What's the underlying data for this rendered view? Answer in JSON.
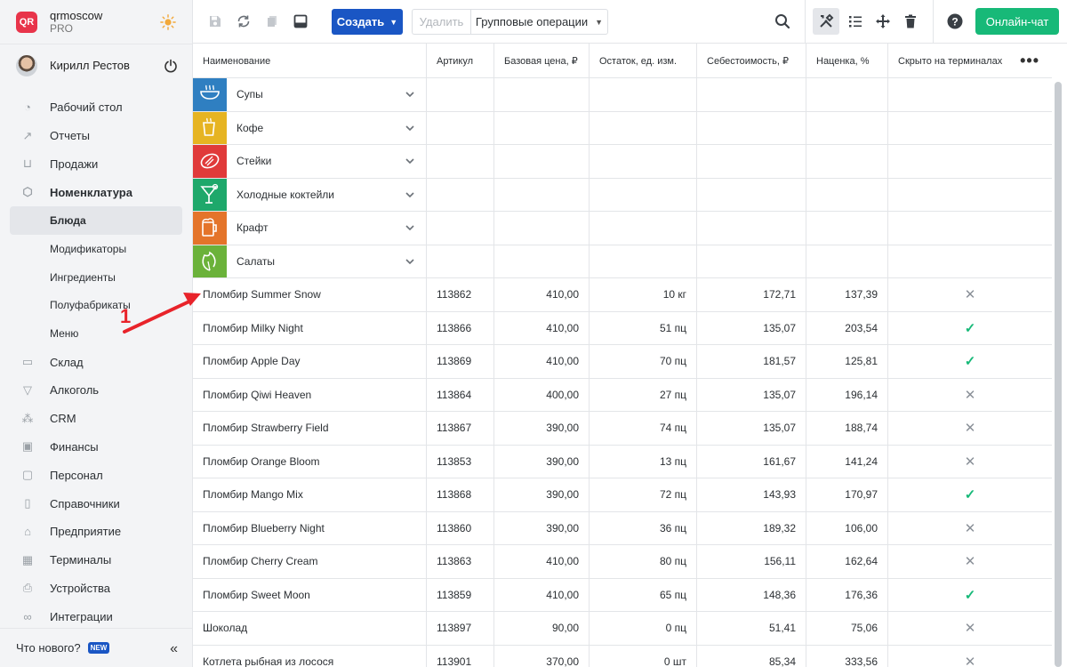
{
  "brand": {
    "name": "qrmoscow",
    "tier": "PRO",
    "logo_text": "QR"
  },
  "user": {
    "name": "Кирилл Рестов"
  },
  "nav": [
    {
      "label": "Рабочий стол",
      "icon": "dashboard-icon",
      "glyph": "◔"
    },
    {
      "label": "Отчеты",
      "icon": "reports-icon",
      "glyph": "↗"
    },
    {
      "label": "Продажи",
      "icon": "basket-icon",
      "glyph": "⊔"
    },
    {
      "label": "Номенклатура",
      "icon": "tag-icon",
      "glyph": "⬡"
    },
    {
      "label": "Блюда",
      "sub": true
    },
    {
      "label": "Модификаторы",
      "sub": true
    },
    {
      "label": "Ингредиенты",
      "sub": true
    },
    {
      "label": "Полуфабрикаты",
      "sub": true
    },
    {
      "label": "Меню",
      "sub": true
    },
    {
      "label": "Склад",
      "icon": "box-icon",
      "glyph": "▭"
    },
    {
      "label": "Алкоголь",
      "icon": "glass-icon",
      "glyph": "▽"
    },
    {
      "label": "CRM",
      "icon": "people-icon",
      "glyph": "⁂"
    },
    {
      "label": "Финансы",
      "icon": "wallet-icon",
      "glyph": "▣"
    },
    {
      "label": "Персонал",
      "icon": "badge-icon",
      "glyph": "▢"
    },
    {
      "label": "Справочники",
      "icon": "book-icon",
      "glyph": "▯"
    },
    {
      "label": "Предприятие",
      "icon": "building-icon",
      "glyph": "⌂"
    },
    {
      "label": "Терминалы",
      "icon": "terminal-icon",
      "glyph": "▦"
    },
    {
      "label": "Устройства",
      "icon": "printer-icon",
      "glyph": "⎙"
    },
    {
      "label": "Интеграции",
      "icon": "link-icon",
      "glyph": "∞"
    }
  ],
  "footer": {
    "whats_new": "Что нового?",
    "new_badge": "NEW"
  },
  "toolbar": {
    "create_label": "Создать",
    "delete_label": "Удалить",
    "group_ops_label": "Групповые операции",
    "chat_label": "Онлайн-чат"
  },
  "table": {
    "headers": [
      "Наименование",
      "Артикул",
      "Базовая цена, ₽",
      "Остаток, ед. изм.",
      "Себестоимость, ₽",
      "Наценка, %",
      "Скрыто на терминалах"
    ],
    "categories": [
      {
        "label": "Супы",
        "color": "#2f7fc1",
        "icon": "soup-icon"
      },
      {
        "label": "Кофе",
        "color": "#e6b422",
        "icon": "coffee-icon"
      },
      {
        "label": "Стейки",
        "color": "#e03a3a",
        "icon": "steak-icon"
      },
      {
        "label": "Холодные коктейли",
        "color": "#1ea86b",
        "icon": "cocktail-icon"
      },
      {
        "label": "Крафт",
        "color": "#e4742a",
        "icon": "beer-icon"
      },
      {
        "label": "Салаты",
        "color": "#6bb23a",
        "icon": "salad-icon"
      }
    ],
    "rows": [
      {
        "name": "Пломбир Summer Snow",
        "article": "113862",
        "price": "410,00",
        "stock": "10 кг",
        "cost": "172,71",
        "markup": "137,39",
        "hidden": false
      },
      {
        "name": "Пломбир Milky Night",
        "article": "113866",
        "price": "410,00",
        "stock": "51 пц",
        "cost": "135,07",
        "markup": "203,54",
        "hidden": true
      },
      {
        "name": "Пломбир Apple Day",
        "article": "113869",
        "price": "410,00",
        "stock": "70 пц",
        "cost": "181,57",
        "markup": "125,81",
        "hidden": true
      },
      {
        "name": "Пломбир Qiwi Heaven",
        "article": "113864",
        "price": "400,00",
        "stock": "27 пц",
        "cost": "135,07",
        "markup": "196,14",
        "hidden": false
      },
      {
        "name": "Пломбир Strawberry Field",
        "article": "113867",
        "price": "390,00",
        "stock": "74 пц",
        "cost": "135,07",
        "markup": "188,74",
        "hidden": false
      },
      {
        "name": "Пломбир Orange Bloom",
        "article": "113853",
        "price": "390,00",
        "stock": "13 пц",
        "cost": "161,67",
        "markup": "141,24",
        "hidden": false
      },
      {
        "name": "Пломбир Mango Mix",
        "article": "113868",
        "price": "390,00",
        "stock": "72 пц",
        "cost": "143,93",
        "markup": "170,97",
        "hidden": true
      },
      {
        "name": "Пломбир Blueberry Night",
        "article": "113860",
        "price": "390,00",
        "stock": "36 пц",
        "cost": "189,32",
        "markup": "106,00",
        "hidden": false
      },
      {
        "name": "Пломбир Cherry Cream",
        "article": "113863",
        "price": "410,00",
        "stock": "80 пц",
        "cost": "156,11",
        "markup": "162,64",
        "hidden": false
      },
      {
        "name": "Пломбир Sweet Moon",
        "article": "113859",
        "price": "410,00",
        "stock": "65 пц",
        "cost": "148,36",
        "markup": "176,36",
        "hidden": true
      },
      {
        "name": "Шоколад",
        "article": "113897",
        "price": "90,00",
        "stock": "0 пц",
        "cost": "51,41",
        "markup": "75,06",
        "hidden": false
      },
      {
        "name": "Котлета рыбная из лосося",
        "article": "113901",
        "price": "370,00",
        "stock": "0 шт",
        "cost": "85,34",
        "markup": "333,56",
        "hidden": false
      }
    ]
  },
  "annotation": {
    "number": "1",
    "color": "#e8232a"
  }
}
